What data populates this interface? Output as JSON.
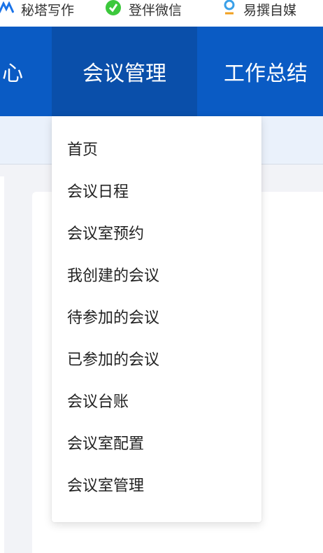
{
  "bookmarks": [
    {
      "label": "秘塔写作",
      "icon": "metaso-icon",
      "color": "#1a73e8"
    },
    {
      "label": "登伴微信",
      "icon": "check-circle-icon",
      "color": "#3cc83c"
    },
    {
      "label": "易撰自媒",
      "icon": "pin-icon",
      "color": "#3aa0e8"
    }
  ],
  "nav": {
    "items": [
      {
        "label": "心"
      },
      {
        "label": "会议管理"
      },
      {
        "label": "工作总结"
      }
    ]
  },
  "menu": {
    "items": [
      {
        "label": "首页"
      },
      {
        "label": "会议日程"
      },
      {
        "label": "会议室预约"
      },
      {
        "label": "我创建的会议"
      },
      {
        "label": "待参加的会议"
      },
      {
        "label": "已参加的会议"
      },
      {
        "label": "会议台账"
      },
      {
        "label": "会议室配置"
      },
      {
        "label": "会议室管理"
      }
    ]
  },
  "colors": {
    "nav_bg": "#0a5bc4",
    "nav_active": "#0a4faa",
    "page_bg": "#f2f3f7"
  }
}
